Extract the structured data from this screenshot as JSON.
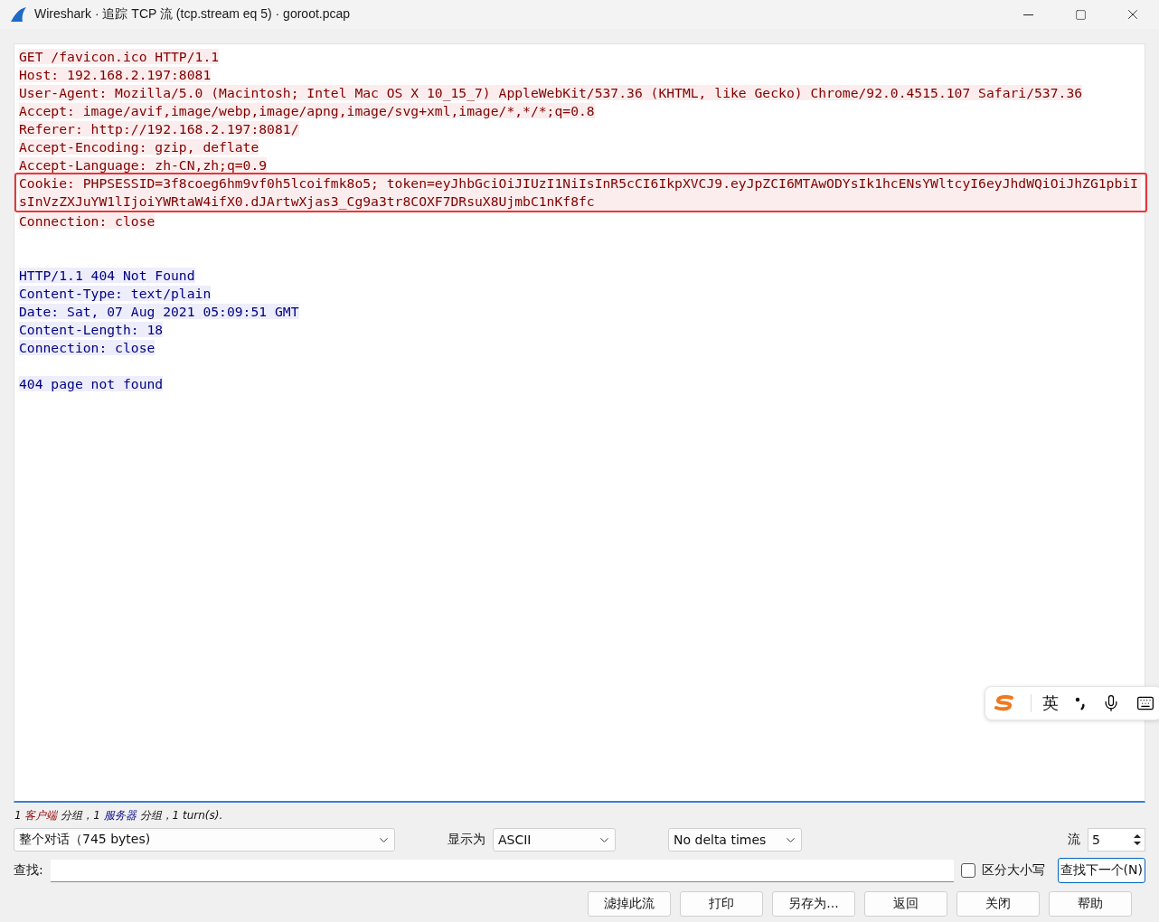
{
  "window": {
    "title": "Wireshark · 追踪 TCP 流 (tcp.stream eq 5) · goroot.pcap"
  },
  "stream": [
    {
      "kind": "client",
      "lines": [
        {
          "text": "GET /favicon.ico HTTP/1.1",
          "highlighted": false
        },
        {
          "text": "Host: 192.168.2.197:8081",
          "highlighted": false
        },
        {
          "text": "User-Agent: Mozilla/5.0 (Macintosh; Intel Mac OS X 10_15_7) AppleWebKit/537.36 (KHTML, like Gecko) Chrome/92.0.4515.107 Safari/537.36",
          "highlighted": false
        },
        {
          "text": "Accept: image/avif,image/webp,image/apng,image/svg+xml,image/*,*/*;q=0.8",
          "highlighted": false
        },
        {
          "text": "Referer: http://192.168.2.197:8081/",
          "highlighted": false
        },
        {
          "text": "Accept-Encoding: gzip, deflate",
          "highlighted": false
        },
        {
          "text": "Accept-Language: zh-CN,zh;q=0.9",
          "highlighted": false
        },
        {
          "text": "Cookie: PHPSESSID=3f8coeg6hm9vf0h5lcoifmk8o5; token=eyJhbGciOiJIUzI1NiIsInR5cCI6IkpXVCJ9.eyJpZCI6MTAwODYsIk1hcENsYWltcyI6eyJhdWQiOiJhZG1pbiIsInVzZXJuYW1lIjoiYWRtaW4ifX0.dJArtwXjas3_Cg9a3tr8COXF7DRsuX8UjmbC1nKf8fc",
          "highlighted": true
        },
        {
          "text": "Connection: close",
          "highlighted": false
        }
      ]
    },
    {
      "kind": "server",
      "lines": [
        {
          "text": "HTTP/1.1 404 Not Found",
          "highlighted": false
        },
        {
          "text": "Content-Type: text/plain",
          "highlighted": false
        },
        {
          "text": "Date: Sat, 07 Aug 2021 05:09:51 GMT",
          "highlighted": false
        },
        {
          "text": "Content-Length: 18",
          "highlighted": false
        },
        {
          "text": "Connection: close",
          "highlighted": false
        }
      ]
    },
    {
      "kind": "server",
      "lines": [
        {
          "text": "404 page not found",
          "highlighted": false
        }
      ]
    }
  ],
  "ime_bar": {
    "mode": "英"
  },
  "summary": [
    {
      "kind": "plain",
      "text": "1 "
    },
    {
      "kind": "client",
      "text": "客户端"
    },
    {
      "kind": "plain",
      "text": " 分组，1 "
    },
    {
      "kind": "server",
      "text": "服务器"
    },
    {
      "kind": "plain",
      "text": " 分组，1 turn(s)."
    }
  ],
  "conversation_select": {
    "value": "整个对话（745 bytes)"
  },
  "show_as": {
    "label": "显示为",
    "value": "ASCII"
  },
  "delta_select": {
    "value": "No delta times"
  },
  "stream_number": {
    "label": "流",
    "value": "5"
  },
  "find": {
    "label": "查找:",
    "case_sensitive": {
      "label": "区分大小写",
      "checked": false
    },
    "find_next": "查找下一个(N)"
  },
  "buttons": [
    "滤掉此流",
    "打印",
    "另存为...",
    "返回",
    "关闭",
    "帮助"
  ]
}
